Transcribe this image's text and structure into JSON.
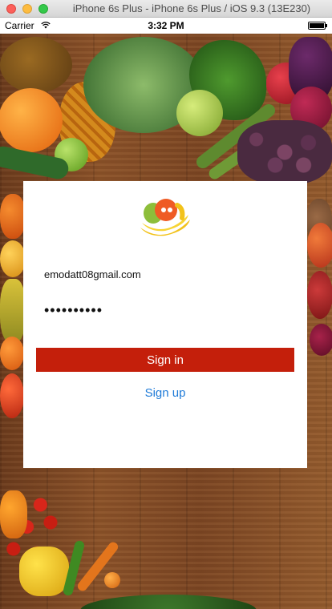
{
  "window": {
    "title": "iPhone 6s Plus - iPhone 6s Plus / iOS 9.3 (13E230)"
  },
  "status_bar": {
    "carrier": "Carrier",
    "time": "3:32 PM",
    "wifi_icon": "wifi-icon",
    "battery_icon": "battery-icon",
    "battery_level": 1.0
  },
  "login": {
    "logo_icon": "fruit-basket-logo",
    "email_value": "emodatt08gmail.com",
    "password_value": "••••••••••",
    "signin_label": "Sign in",
    "signup_label": "Sign up",
    "colors": {
      "signin_background": "#c41f0b",
      "signup_text": "#1f7bd8",
      "card_background": "#ffffff"
    }
  },
  "background": {
    "description_icon": "vegetables-on-wood-background"
  }
}
